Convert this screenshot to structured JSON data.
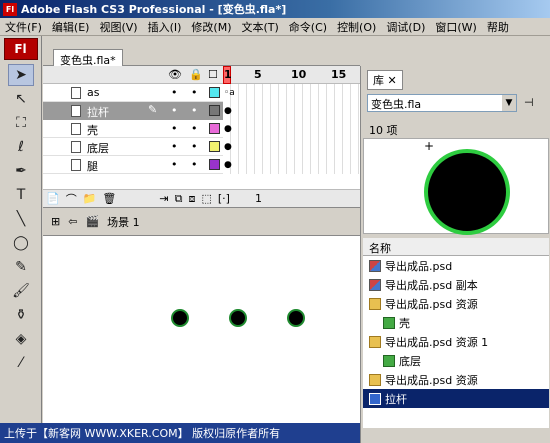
{
  "window": {
    "title": "Adobe Flash CS3 Professional - [变色虫.fla*]",
    "app_icon": "Fl"
  },
  "menu": [
    "文件(F)",
    "编辑(E)",
    "视图(V)",
    "插入(I)",
    "修改(M)",
    "文本(T)",
    "命令(C)",
    "控制(O)",
    "调试(D)",
    "窗口(W)",
    "帮助"
  ],
  "tools": {
    "logo": "Fl"
  },
  "document": {
    "tab": "变色虫.fla*"
  },
  "timeline": {
    "frame_numbers": [
      "1",
      "5",
      "10",
      "15"
    ],
    "layers": [
      {
        "name": "as",
        "color": "#55e8f0"
      },
      {
        "name": "拉杆",
        "color": "#777777"
      },
      {
        "name": "壳",
        "color": "#e86ad8"
      },
      {
        "name": "底层",
        "color": "#f0f070"
      },
      {
        "name": "腿",
        "color": "#9933cc"
      }
    ],
    "footer_frame": "1"
  },
  "editbar": {
    "scene": "场景 1"
  },
  "library": {
    "tab": "库",
    "file": "变色虫.fla",
    "count": "10 项",
    "column": "名称",
    "items": [
      {
        "name": "导出成品.psd",
        "icon": "bitmap-icon"
      },
      {
        "name": "导出成品.psd 副本",
        "icon": "bitmap-icon"
      },
      {
        "name": "导出成品.psd 资源",
        "icon": "folder-icon"
      },
      {
        "name": "壳",
        "icon": "graphic-icon",
        "indent": true
      },
      {
        "name": "导出成品.psd 资源 1",
        "icon": "folder-icon"
      },
      {
        "name": "底层",
        "icon": "graphic-icon",
        "indent": true
      },
      {
        "name": "导出成品.psd 资源",
        "icon": "folder-icon"
      },
      {
        "name": "拉杆",
        "icon": "movieclip-icon"
      }
    ]
  },
  "watermark": "上传于【新客网 WWW.XKER.COM】 版权归原作者所有"
}
